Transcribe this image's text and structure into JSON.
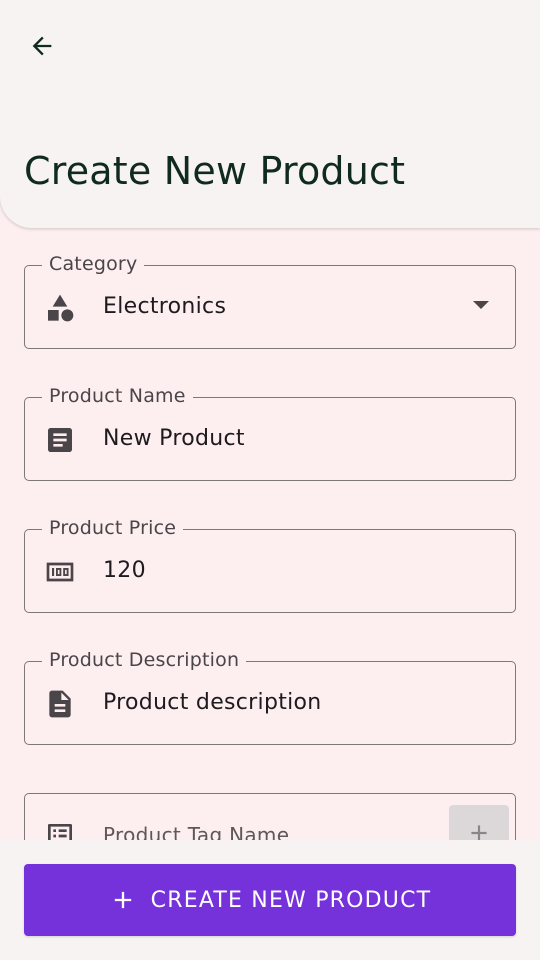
{
  "header": {
    "title": "Create New Product",
    "back_icon": "arrow-back-icon"
  },
  "form": {
    "category": {
      "label": "Category",
      "value": "Electronics",
      "icon": "category-shapes-icon"
    },
    "product_name": {
      "label": "Product Name",
      "value": "New Product",
      "icon": "article-icon"
    },
    "product_price": {
      "label": "Product Price",
      "value": "120",
      "icon": "money-icon"
    },
    "product_description": {
      "label": "Product Description",
      "value": "Product description",
      "icon": "description-icon"
    },
    "product_tag": {
      "placeholder": "Product Tag Name",
      "icon": "list-alt-icon",
      "add_icon": "plus-icon"
    }
  },
  "actions": {
    "create_label": "Create New Product",
    "create_icon": "plus-icon"
  },
  "colors": {
    "background": "#fdeef0",
    "surface": "#f7f3f3",
    "primary": "#7531da",
    "outline": "#7d7779",
    "title": "#102a22"
  }
}
